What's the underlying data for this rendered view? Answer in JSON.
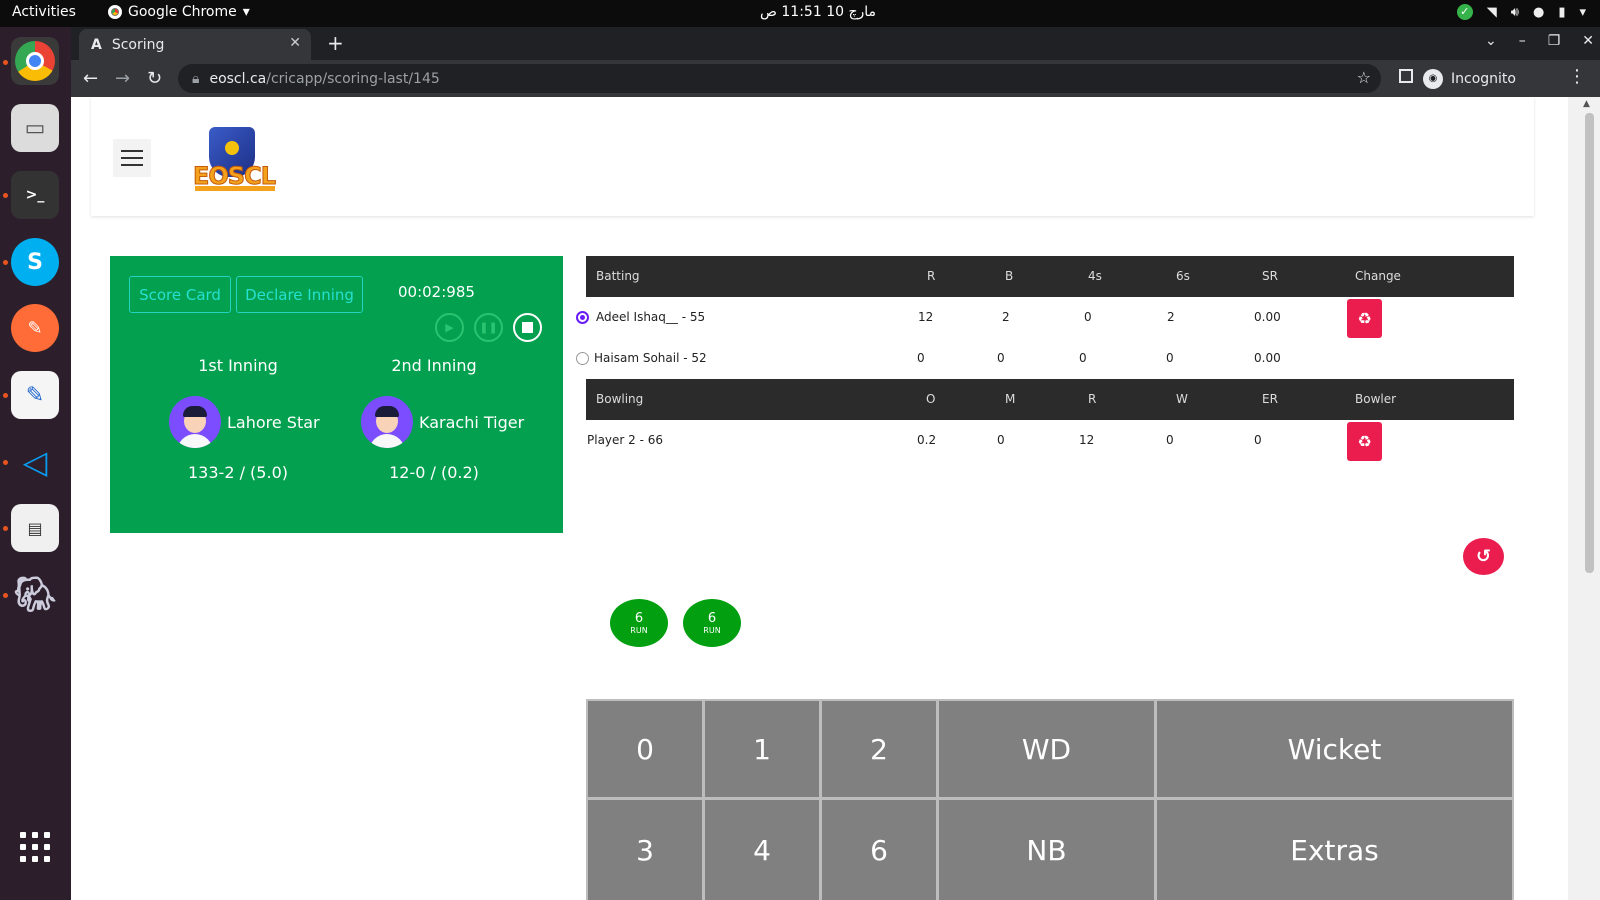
{
  "system": {
    "activities": "Activities",
    "app_name": "Google Chrome",
    "clock": "مارچ 10  11:51 ص"
  },
  "browser": {
    "tab_title": "Scoring",
    "url_host": "eoscl.ca",
    "url_path": "/cricapp/scoring-last/145",
    "incognito": "Incognito"
  },
  "logo": {
    "text": "EOSCL"
  },
  "panel": {
    "score_card": "Score Card",
    "declare_inning": "Declare Inning",
    "timer": "00:02:985",
    "inning1": {
      "label": "1st Inning",
      "team": "Lahore Star",
      "score": "133-2 / (5.0)"
    },
    "inning2": {
      "label": "2nd Inning",
      "team": "Karachi Tiger",
      "score": "12-0 / (0.2)"
    }
  },
  "batting": {
    "headers": [
      "Batting",
      "R",
      "B",
      "4s",
      "6s",
      "SR",
      "Change"
    ],
    "rows": [
      {
        "name": "Adeel Ishaq__ - 55",
        "r": "12",
        "b": "2",
        "fours": "0",
        "sixes": "2",
        "sr": "0.00",
        "selected": true
      },
      {
        "name": "Haisam Sohail - 52",
        "r": "0",
        "b": "0",
        "fours": "0",
        "sixes": "0",
        "sr": "0.00",
        "selected": false
      }
    ]
  },
  "bowling": {
    "headers": [
      "Bowling",
      "O",
      "M",
      "R",
      "W",
      "ER",
      "Bowler"
    ],
    "rows": [
      {
        "name": "Player 2 - 66",
        "o": "0.2",
        "m": "0",
        "r": "12",
        "w": "0",
        "er": "0"
      }
    ]
  },
  "recent_balls": [
    {
      "value": "6",
      "unit": "RUN"
    },
    {
      "value": "6",
      "unit": "RUN"
    }
  ],
  "keypad": {
    "k0": "0",
    "k1": "1",
    "k2": "2",
    "wd": "WD",
    "wicket": "Wicket",
    "k3": "3",
    "k4": "4",
    "k6": "6",
    "nb": "NB",
    "extras": "Extras"
  },
  "colors": {
    "panel_green": "#02a04f",
    "accent_red": "#ea1d4e",
    "ball_green": "#02a010",
    "table_header": "#2b2b2b",
    "keypad_gray": "#808080"
  }
}
